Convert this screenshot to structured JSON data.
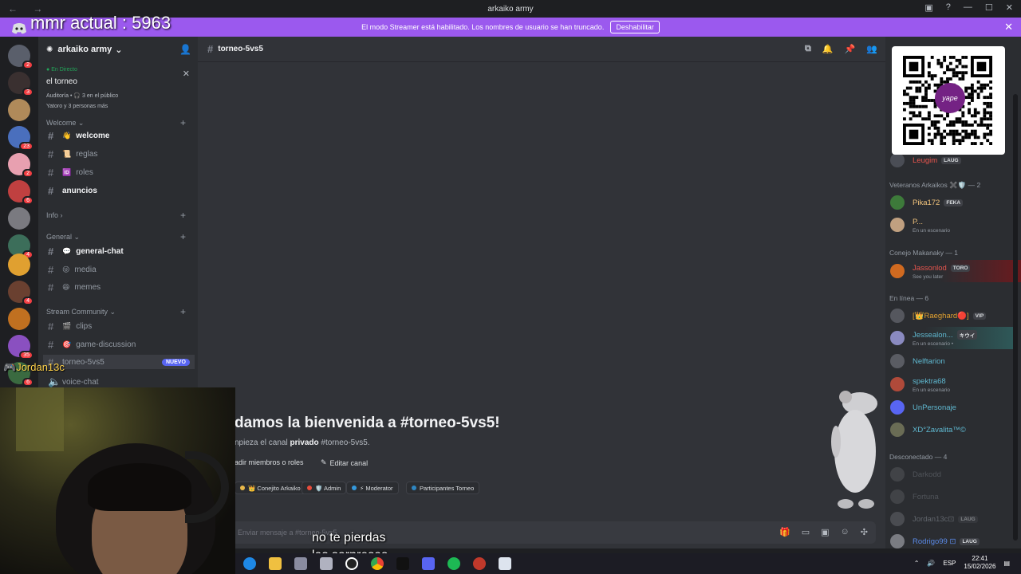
{
  "overlay": {
    "mmr": "mmr actual : 5963",
    "cam_user": "Jordan13c",
    "subtitle_line1": "no te pierdas",
    "subtitle_line2": "las sorpresas"
  },
  "window": {
    "title": "arkaiko army"
  },
  "banner": {
    "text": "El modo Streamer está habilitado. Los nombres de usuario se han truncado.",
    "button": "Deshabilitar"
  },
  "guilds": [
    {
      "badge": "2",
      "color": "#5a5f6b"
    },
    {
      "badge": "3",
      "color": "#3a3030"
    },
    {
      "badge": "",
      "color": "#b08a5a"
    },
    {
      "badge": "23",
      "color": "#4a6fbd"
    },
    {
      "badge": "2",
      "color": "#e8a0b0"
    },
    {
      "badge": "6",
      "color": "#c04040"
    },
    {
      "badge": "",
      "color": "#7a7a80"
    },
    {
      "badge": "4",
      "color": "#3c6e5a"
    },
    {
      "badge": "",
      "color": "#e0a030"
    },
    {
      "badge": "4",
      "color": "#6a4030"
    },
    {
      "badge": "",
      "color": "#c07020"
    },
    {
      "badge": "35",
      "color": "#8a50c0"
    },
    {
      "badge": "6",
      "color": "#3a6a40"
    }
  ],
  "server": {
    "name": "arkaiko army"
  },
  "live": {
    "label": "En Directo",
    "title": "el torneo",
    "info": "Auditoría • 🎧 3 en el público",
    "who": "Yatoro y 3 personas más"
  },
  "sidebar": {
    "categories": {
      "welcome": "Welcome",
      "info": "Info",
      "general": "General",
      "stream": "Stream Community"
    },
    "channels": [
      {
        "name": "welcome",
        "emoji": "👋",
        "bold": true
      },
      {
        "name": "reglas",
        "emoji": "📜",
        "bold": false
      },
      {
        "name": "roles",
        "emoji": "🆔",
        "bold": false
      },
      {
        "name": "anuncios",
        "emoji": "",
        "bold": true
      },
      {
        "name": "general-chat",
        "emoji": "💬",
        "bold": true
      },
      {
        "name": "media",
        "emoji": "😜",
        "bold": false
      },
      {
        "name": "memes",
        "emoji": "😆",
        "bold": false
      },
      {
        "name": "clips",
        "emoji": "🎬",
        "bold": false
      },
      {
        "name": "game-discussion",
        "emoji": "🎯",
        "bold": false
      },
      {
        "name": "torneo-5vs5",
        "emoji": "",
        "bold": false
      },
      {
        "name": "voice-chat",
        "emoji": "",
        "bold": false
      }
    ],
    "new_badge": "NUEVO"
  },
  "header": {
    "channel": "torneo-5vs5"
  },
  "welcome": {
    "title": "damos la bienvenida a #torneo-5vs5!",
    "sub_prefix": "npieza el canal ",
    "sub_bold": "privado",
    "sub_suffix": " #torneo-5vs5.",
    "add_members": "adir miembros o roles",
    "edit_channel": "Editar canal"
  },
  "roles": [
    {
      "name": "👑 Conejito Arkaiko",
      "color": "#e8b84a"
    },
    {
      "name": "🛡️ Admin",
      "color": "#e74c3c"
    },
    {
      "name": "⚡ Moderator",
      "color": "#3498db"
    },
    {
      "name": "Participantes Torneo",
      "color": "#2e86c1"
    }
  ],
  "composer": {
    "placeholder": "Enviar mensaje a #torneo-5vs5"
  },
  "members": {
    "leugim": {
      "name": "Leugim",
      "tag": "LAUG"
    },
    "cat_veteranos": "Veteranos Arkaikos ✖️🛡️ — 2",
    "pika": {
      "name": "Pika172",
      "tag": "FEKA"
    },
    "p": {
      "name": "P...",
      "status": "En un escenario"
    },
    "cat_conejo": "Conejo Makanaky — 1",
    "jasson": {
      "name": "Jassonlod",
      "tag": "TORO",
      "status": "See you later"
    },
    "cat_online": "En línea — 6",
    "raeghard": {
      "name": "[👑Raeghard🔴]",
      "tag": "VIP"
    },
    "jesse": {
      "name": "Jessealon...",
      "tag": "キウイ",
      "status": "En un escenario •"
    },
    "nelf": {
      "name": "Nelftarion"
    },
    "spektra": {
      "name": "spektra68",
      "status": "En un escenario"
    },
    "unper": {
      "name": "UnPersonaje"
    },
    "xd": {
      "name": "XD°Zavalita™©"
    },
    "cat_offline": "Desconectado — 4",
    "off1": {
      "name": "Darkodd"
    },
    "off2": {
      "name": "Fortuna"
    },
    "jordan": {
      "name": "Jordan13c⊡",
      "tag": "LAUG"
    },
    "rodrigo": {
      "name": "Rodrigo99 ⊡",
      "tag": "LAUG"
    }
  },
  "taskbar": {
    "lang": "ESP",
    "time": "22:41",
    "date": "15/02/2026"
  }
}
